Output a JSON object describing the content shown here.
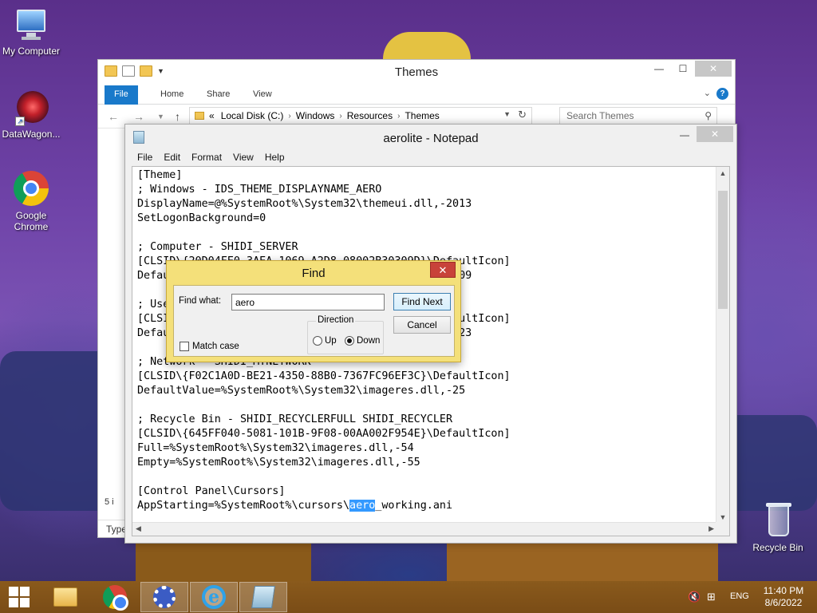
{
  "desktop": {
    "icons": [
      {
        "label": "My Computer"
      },
      {
        "label": "DataWagon..."
      },
      {
        "label": "Google\nChrome"
      },
      {
        "label": "Recycle Bin"
      }
    ]
  },
  "explorer": {
    "title": "Themes",
    "tabs": [
      "File",
      "Home",
      "Share",
      "View"
    ],
    "address": {
      "prefix": "«",
      "crumbs": [
        "Local Disk (C:)",
        "Windows",
        "Resources",
        "Themes"
      ]
    },
    "search_placeholder": "Search Themes",
    "status_partial": "Type",
    "side_partial": "5 i"
  },
  "notepad": {
    "title": "aerolite - Notepad",
    "menu": [
      "File",
      "Edit",
      "Format",
      "View",
      "Help"
    ],
    "lines": [
      "[Theme]",
      "; Windows - IDS_THEME_DISPLAYNAME_AERO",
      "DisplayName=@%SystemRoot%\\System32\\themeui.dll,-2013",
      "SetLogonBackground=0",
      "",
      "; Computer - SHIDI_SERVER",
      "[CLSID\\{20D04FE0-3AEA-1069-A2D8-08002B30309D}\\DefaultIcon]",
      "DefaultValue=%SystemRoot%\\System32\\imageres.dll,-109",
      "",
      "; UsersFiles - SHIDI_USERFILES",
      "[CLSID\\{59031A47-3F72-44A7-89C5-5595FE6B30EE}\\DefaultIcon]",
      "DefaultValue=%SystemRoot%\\System32\\imageres.dll,-123",
      "",
      "; Network - SHIDI_MYNETWORK",
      "[CLSID\\{F02C1A0D-BE21-4350-88B0-7367FC96EF3C}\\DefaultIcon]",
      "DefaultValue=%SystemRoot%\\System32\\imageres.dll,-25",
      "",
      "; Recycle Bin - SHIDI_RECYCLERFULL SHIDI_RECYCLER",
      "[CLSID\\{645FF040-5081-101B-9F08-00AA002F954E}\\DefaultIcon]",
      "Full=%SystemRoot%\\System32\\imageres.dll,-54",
      "Empty=%SystemRoot%\\System32\\imageres.dll,-55",
      "",
      "[Control Panel\\Cursors]"
    ],
    "last_line": {
      "before": "AppStarting=%SystemRoot%\\cursors\\",
      "selected": "aero",
      "after": "_working.ani"
    }
  },
  "find_dialog": {
    "title": "Find",
    "find_what_label": "Find what:",
    "find_what_value": "aero",
    "find_next_label": "Find Next",
    "cancel_label": "Cancel",
    "direction_label": "Direction",
    "up_label": "Up",
    "down_label": "Down",
    "direction_selected": "Down",
    "match_case_label": "Match case",
    "match_case_checked": false
  },
  "taskbar": {
    "items": [
      "start-button",
      "file-explorer-icon",
      "chrome-icon",
      "control-panel-icon",
      "internet-explorer-icon",
      "notepad-icon"
    ],
    "language": "ENG",
    "time": "11:40 PM",
    "date": "8/6/2022"
  },
  "colors": {
    "find_dialog_frame": "#f4e07a",
    "selection": "#3399ff",
    "ribbon_file_tab": "#1979ca",
    "close_button": "#c8423a"
  }
}
